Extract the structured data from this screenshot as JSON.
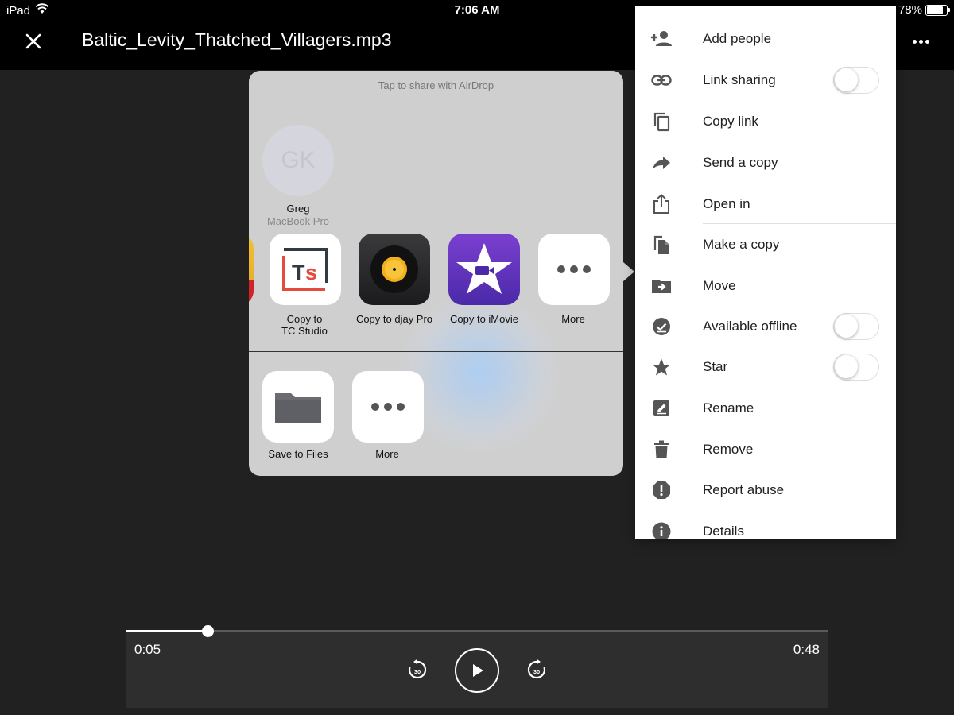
{
  "status_bar": {
    "device": "iPad",
    "time": "7:06 AM",
    "battery": "78%"
  },
  "header": {
    "title": "Baltic_Levity_Thatched_Villagers.mp3",
    "close_icon": "close-icon",
    "more_icon": "more-horizontal-icon"
  },
  "share_sheet": {
    "airdrop_hint": "Tap to share with AirDrop",
    "airdrop_device": {
      "initials": "GK",
      "name": "Greg",
      "device": "MacBook Pro"
    },
    "apps": [
      {
        "label": "Copy to\nTC Studio",
        "icon": "tc-studio-icon"
      },
      {
        "label": "Copy to djay Pro",
        "icon": "djay-pro-icon"
      },
      {
        "label": "Copy to iMovie",
        "icon": "imovie-icon"
      },
      {
        "label": "More",
        "icon": "more-icon"
      }
    ],
    "actions": [
      {
        "label": "Save to Files",
        "icon": "folder-icon"
      },
      {
        "label": "More",
        "icon": "more-icon"
      }
    ]
  },
  "menu": {
    "items": [
      {
        "label": "Add people",
        "icon": "add-person-icon"
      },
      {
        "label": "Link sharing",
        "icon": "link-icon",
        "toggle": false
      },
      {
        "label": "Copy link",
        "icon": "copy-icon"
      },
      {
        "label": "Send a copy",
        "icon": "share-arrow-icon"
      },
      {
        "label": "Open in",
        "icon": "open-in-icon"
      },
      {
        "label": "Make a copy",
        "icon": "file-copy-icon"
      },
      {
        "label": "Move",
        "icon": "move-folder-icon"
      },
      {
        "label": "Available offline",
        "icon": "offline-check-icon",
        "toggle": false
      },
      {
        "label": "Star",
        "icon": "star-icon",
        "toggle": false
      },
      {
        "label": "Rename",
        "icon": "rename-icon"
      },
      {
        "label": "Remove",
        "icon": "trash-icon"
      },
      {
        "label": "Report abuse",
        "icon": "report-icon"
      },
      {
        "label": "Details",
        "icon": "info-icon"
      }
    ]
  },
  "player": {
    "current_time": "0:05",
    "total_time": "0:48",
    "progress": 0.116,
    "rewind_label": "30",
    "forward_label": "30"
  }
}
